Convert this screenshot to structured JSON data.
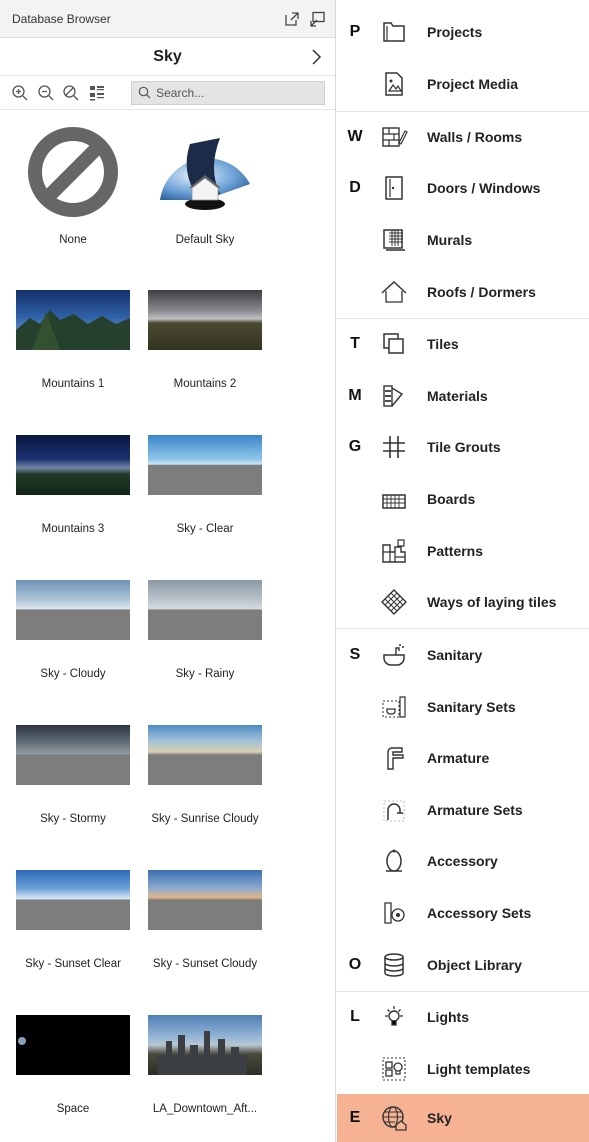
{
  "window": {
    "title": "Database Browser"
  },
  "category": {
    "title": "Sky"
  },
  "search": {
    "placeholder": "Search..."
  },
  "thumbnails": [
    {
      "label": "None"
    },
    {
      "label": "Default Sky"
    },
    {
      "label": "Mountains 1"
    },
    {
      "label": "Mountains 2"
    },
    {
      "label": "Mountains 3"
    },
    {
      "label": "Sky - Clear"
    },
    {
      "label": "Sky - Cloudy"
    },
    {
      "label": "Sky - Rainy"
    },
    {
      "label": "Sky - Stormy"
    },
    {
      "label": "Sky - Sunrise Cloudy"
    },
    {
      "label": "Sky - Sunset Clear"
    },
    {
      "label": "Sky - Sunset Cloudy"
    },
    {
      "label": "Space"
    },
    {
      "label": "LA_Downtown_Aft..."
    }
  ],
  "menu": {
    "items": [
      {
        "letter": "P",
        "label": "Projects",
        "icon": "folder-icon"
      },
      {
        "letter": "",
        "label": "Project Media",
        "icon": "media-file-icon"
      },
      {
        "letter": "W",
        "label": "Walls / Rooms",
        "icon": "walls-icon"
      },
      {
        "letter": "D",
        "label": "Doors / Windows",
        "icon": "door-icon"
      },
      {
        "letter": "",
        "label": "Murals",
        "icon": "mural-icon"
      },
      {
        "letter": "",
        "label": "Roofs / Dormers",
        "icon": "roof-icon"
      },
      {
        "letter": "T",
        "label": "Tiles",
        "icon": "tiles-icon"
      },
      {
        "letter": "M",
        "label": "Materials",
        "icon": "materials-icon"
      },
      {
        "letter": "G",
        "label": "Tile Grouts",
        "icon": "grout-icon"
      },
      {
        "letter": "",
        "label": "Boards",
        "icon": "boards-icon"
      },
      {
        "letter": "",
        "label": "Patterns",
        "icon": "patterns-icon"
      },
      {
        "letter": "",
        "label": "Ways of laying tiles",
        "icon": "laying-tiles-icon"
      },
      {
        "letter": "S",
        "label": "Sanitary",
        "icon": "sanitary-icon"
      },
      {
        "letter": "",
        "label": "Sanitary Sets",
        "icon": "sanitary-sets-icon"
      },
      {
        "letter": "",
        "label": "Armature",
        "icon": "faucet-icon"
      },
      {
        "letter": "",
        "label": "Armature Sets",
        "icon": "armature-sets-icon"
      },
      {
        "letter": "",
        "label": "Accessory",
        "icon": "accessory-icon"
      },
      {
        "letter": "",
        "label": "Accessory Sets",
        "icon": "accessory-sets-icon"
      },
      {
        "letter": "O",
        "label": "Object Library",
        "icon": "database-icon"
      },
      {
        "letter": "L",
        "label": "Lights",
        "icon": "light-bulb-icon"
      },
      {
        "letter": "",
        "label": "Light templates",
        "icon": "light-templates-icon"
      },
      {
        "letter": "E",
        "label": "Sky",
        "icon": "globe-house-icon",
        "active": true
      }
    ]
  },
  "colors": {
    "active_bg": "#f6b394"
  }
}
